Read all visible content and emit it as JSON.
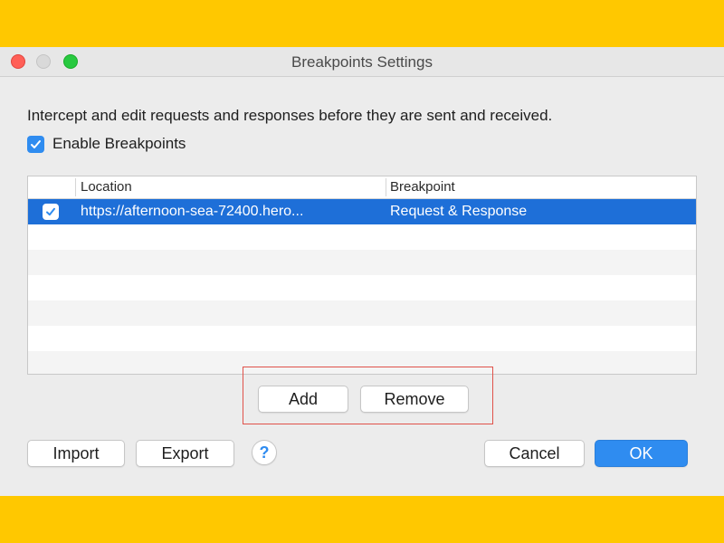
{
  "window": {
    "title": "Breakpoints Settings",
    "controls": {
      "close": "close-button",
      "minimize": "minimize-button",
      "maximize": "maximize-button"
    }
  },
  "description": "Intercept and edit requests and responses before they are sent and received.",
  "enable_breakpoints": {
    "label": "Enable Breakpoints",
    "checked": true
  },
  "table": {
    "columns": [
      "Location",
      "Breakpoint"
    ],
    "rows": [
      {
        "enabled": true,
        "location": "https://afternoon-sea-72400.hero...",
        "breakpoint": "Request & Response",
        "selected": true
      }
    ]
  },
  "buttons": {
    "add": "Add",
    "remove": "Remove",
    "import": "Import",
    "export": "Export",
    "help": "?",
    "cancel": "Cancel",
    "ok": "OK"
  },
  "colors": {
    "background": "#FFC800",
    "window": "#ECECEC",
    "selection": "#1E6FD8",
    "accent": "#2F8CF0",
    "highlight_box": "#E0524A"
  },
  "icons": {
    "checkbox_checked": "checkmark-icon",
    "help": "question-mark-icon"
  }
}
